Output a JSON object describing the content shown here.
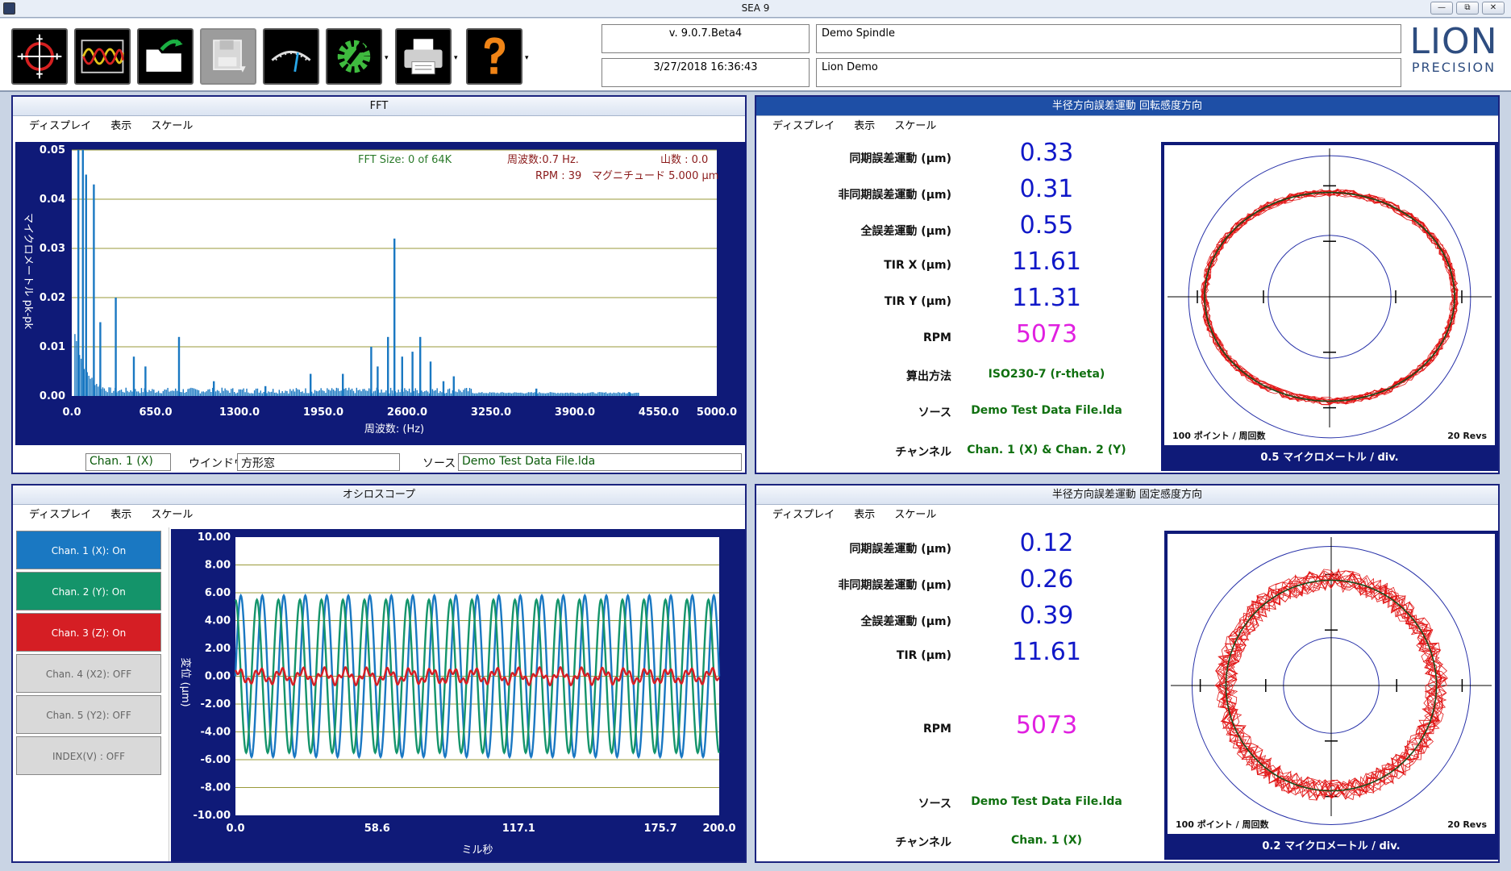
{
  "window": {
    "title": "SEA 9",
    "controls": [
      "—",
      "⧉",
      "✕"
    ]
  },
  "toolbar": {
    "buttons": [
      "target-icon",
      "waveform-icon",
      "open-folder-icon",
      "save-disk-icon",
      "gauge-icon",
      "settings-gear-icon",
      "printer-icon",
      "help-icon"
    ],
    "dropdown_glyph": "▾"
  },
  "info": {
    "version": "v.  9.0.7.Beta4",
    "datetime": "3/27/2018 16:36:43",
    "spindle": "Demo Spindle",
    "operator": "Lion Demo"
  },
  "logo": {
    "line1": "LION",
    "line2": "PRECISION"
  },
  "fft": {
    "title": "FFT",
    "menu": [
      "ディスプレイ",
      "表示",
      "スケール"
    ],
    "ann_size": "FFT Size: 0 of 64K",
    "ann_freq": "周波数:0.7  Hz.",
    "ann_peaks": "山数 : 0.0",
    "ann_rpm": "RPM : 39",
    "ann_mag": "マグニチュード 5.000 µm",
    "channel": "Chan. 1 (X)",
    "window_label": "ウインドウ",
    "window_value": "方形窓",
    "source_label": "ソース",
    "source_value": "Demo Test Data File.lda"
  },
  "rot": {
    "title": "半径方向誤差運動 回転感度方向",
    "menu": [
      "ディスプレイ",
      "表示",
      "スケール"
    ],
    "labels": [
      "同期誤差運動 (µm)",
      "非同期誤差運動 (µm)",
      "全誤差運動 (µm)",
      "TIR X (µm)",
      "TIR Y (µm)",
      "RPM",
      "算出方法",
      "ソース",
      "チャンネル"
    ],
    "values": [
      "0.33",
      "0.31",
      "0.55",
      "11.61",
      "11.31",
      "5073",
      "ISO230-7 (r-theta)",
      "Demo Test Data File.lda",
      "Chan. 1 (X) & Chan. 2 (Y)"
    ],
    "polar_left": "100 ポイント  / 周回数",
    "polar_right": "20 Revs",
    "polar_scale": "0.5 マイクロメートル / div."
  },
  "fixed": {
    "title": "半径方向誤差運動  固定感度方向",
    "menu": [
      "ディスプレイ",
      "表示",
      "スケール"
    ],
    "labels": [
      "同期誤差運動 (µm)",
      "非同期誤差運動 (µm)",
      "全誤差運動 (µm)",
      "TIR (µm)",
      "RPM",
      "ソース",
      "チャンネル"
    ],
    "values": [
      "0.12",
      "0.26",
      "0.39",
      "11.61",
      "5073",
      "Demo Test Data File.lda",
      "Chan. 1 (X)"
    ],
    "polar_left": "100 ポイント  / 周回数",
    "polar_right": "20 Revs",
    "polar_scale": "0.2 マイクロメートル / div."
  },
  "scope": {
    "title": "オシロスコープ",
    "menu": [
      "ディスプレイ",
      "表示",
      "スケール"
    ],
    "channels": [
      "Chan. 1 (X): On",
      "Chan. 2 (Y): On",
      "Chan. 3 (Z): On",
      "Chan. 4 (X2): OFF",
      "Chan. 5 (Y2): OFF",
      "INDEX(V) : OFF"
    ]
  },
  "chart_data": [
    {
      "type": "bar",
      "title": "FFT",
      "xlabel": "周波数: (Hz)",
      "ylabel": "マイクロメートル pk-pk",
      "xlim": [
        0,
        5000
      ],
      "ylim": [
        0,
        0.05
      ],
      "xticks": [
        "0.0",
        "650.0",
        "1300.0",
        "1950.0",
        "2600.0",
        "3250.0",
        "3900.0",
        "4550.0",
        "5000.0"
      ],
      "yticks": [
        "0.00",
        "0.01",
        "0.02",
        "0.03",
        "0.04",
        "0.05"
      ],
      "color": "#1a78c2",
      "peaks": [
        {
          "x": 50,
          "y": 0.05
        },
        {
          "x": 85,
          "y": 0.05
        },
        {
          "x": 110,
          "y": 0.045
        },
        {
          "x": 170,
          "y": 0.043
        },
        {
          "x": 220,
          "y": 0.015
        },
        {
          "x": 340,
          "y": 0.02
        },
        {
          "x": 480,
          "y": 0.008
        },
        {
          "x": 570,
          "y": 0.006
        },
        {
          "x": 830,
          "y": 0.012
        },
        {
          "x": 1100,
          "y": 0.003
        },
        {
          "x": 1500,
          "y": 0.002
        },
        {
          "x": 1850,
          "y": 0.0045
        },
        {
          "x": 2100,
          "y": 0.0045
        },
        {
          "x": 2320,
          "y": 0.01
        },
        {
          "x": 2370,
          "y": 0.006
        },
        {
          "x": 2450,
          "y": 0.012
        },
        {
          "x": 2500,
          "y": 0.032
        },
        {
          "x": 2560,
          "y": 0.008
        },
        {
          "x": 2640,
          "y": 0.009
        },
        {
          "x": 2700,
          "y": 0.012
        },
        {
          "x": 2780,
          "y": 0.007
        },
        {
          "x": 2880,
          "y": 0.003
        },
        {
          "x": 2960,
          "y": 0.004
        },
        {
          "x": 3600,
          "y": 0.0015
        },
        {
          "x": 4320,
          "y": 0.0008
        }
      ]
    },
    {
      "type": "line",
      "title": "オシロスコープ",
      "xlabel": "ミル秒",
      "ylabel": "変位 (µm)",
      "xlim": [
        0,
        200
      ],
      "ylim": [
        -10,
        10
      ],
      "xticks": [
        "0.0",
        "58.6",
        "117.1",
        "175.7",
        "200.0"
      ],
      "yticks": [
        "10.00",
        "8.00",
        "6.00",
        "4.00",
        "2.00",
        "0.00",
        "-2.00",
        "-4.00",
        "-6.00",
        "-8.00",
        "-10.00"
      ],
      "series": [
        {
          "name": "Chan. 1 (X)",
          "color": "#1a78c2",
          "amplitude": 5.8,
          "cycles": 22.5,
          "phase": 0
        },
        {
          "name": "Chan. 2 (Y)",
          "color": "#14946a",
          "amplitude": 5.5,
          "cycles": 22.5,
          "phase": 1.57
        },
        {
          "name": "Chan. 3 (Z)",
          "color": "#d51e24",
          "amplitude": 0.4,
          "cycles": 22.5,
          "phase": 0.8
        }
      ]
    },
    {
      "type": "scatter",
      "title": "半径方向誤差運動 回転感度方向",
      "polar": true,
      "ring_shape": "ellipse",
      "points_per_rev": 100,
      "revs": 20,
      "scale": "0.5 マイクロメートル / div."
    },
    {
      "type": "scatter",
      "title": "半径方向誤差運動  固定感度方向",
      "polar": true,
      "ring_shape": "circle",
      "points_per_rev": 100,
      "revs": 20,
      "scale": "0.2 マイクロメートル / div."
    }
  ]
}
